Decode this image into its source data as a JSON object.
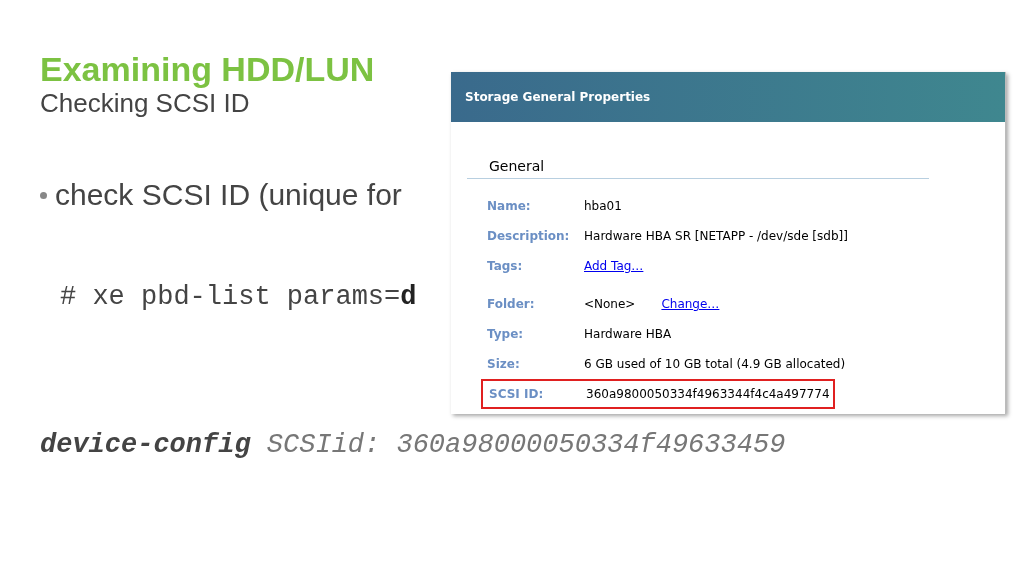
{
  "slide": {
    "title": "Examining HDD/LUN",
    "subtitle": "Checking SCSI ID",
    "bullet": "check SCSI ID (unique for",
    "command": "# xe pbd-list params=**d**",
    "output": "**device-config** SCSIid: 360a98000050334f49633459"
  },
  "dialog": {
    "title": "Storage General Properties",
    "section": "General",
    "rows": [
      {
        "label": "Name:",
        "value": "hba01",
        "highlighted": false
      },
      {
        "label": "Description:",
        "value": "Hardware HBA SR [NETAPP - /dev/sde [sdb]]",
        "highlighted": false
      },
      {
        "label": "Tags:",
        "link": "Add Tag…",
        "highlighted": false
      },
      {
        "label": "Folder:",
        "value": "<None>",
        "link": "Change…",
        "highlighted": false
      },
      {
        "label": "Type:",
        "value": "Hardware HBA",
        "highlighted": false
      },
      {
        "label": "Size:",
        "value": "6 GB used of 10 GB total (4.9 GB allocated)",
        "highlighted": false
      },
      {
        "label": "SCSI ID:",
        "value": "360a9800050334f4963344f4c4a497774",
        "highlighted": true
      }
    ]
  }
}
